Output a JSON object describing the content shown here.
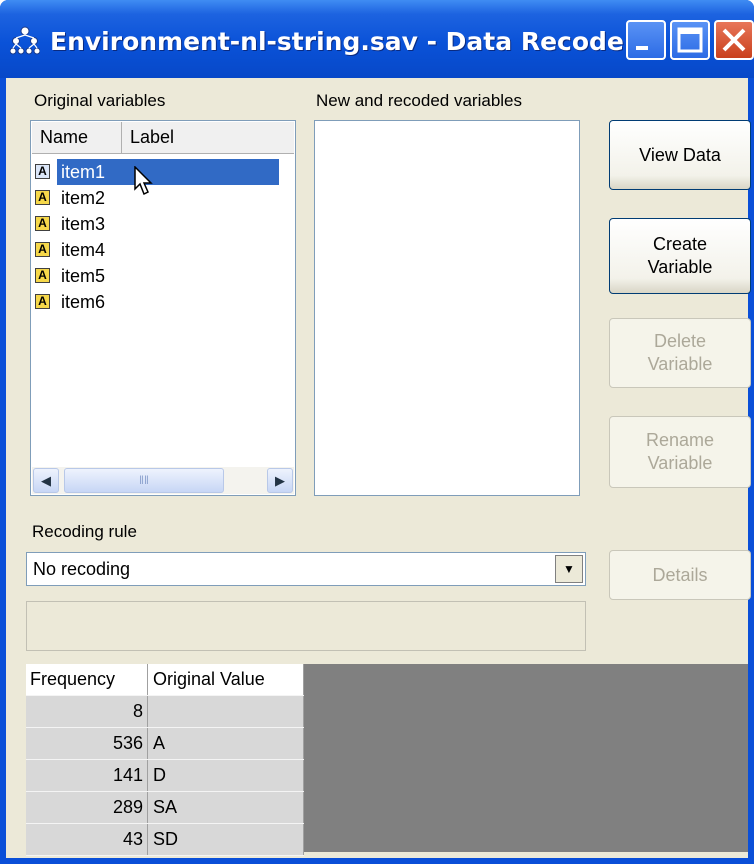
{
  "window": {
    "title": "Environment-nl-string.sav - Data Recode"
  },
  "original_variables": {
    "label": "Original variables",
    "columns": [
      "Name",
      "Label"
    ],
    "items": [
      {
        "name": "item1",
        "selected": true
      },
      {
        "name": "item2",
        "selected": false
      },
      {
        "name": "item3",
        "selected": false
      },
      {
        "name": "item4",
        "selected": false
      },
      {
        "name": "item5",
        "selected": false
      },
      {
        "name": "item6",
        "selected": false
      }
    ],
    "icon": "string-variable-icon"
  },
  "new_variables": {
    "label": "New and recoded variables"
  },
  "buttons": {
    "view_data": "View Data",
    "create_variable_line1": "Create",
    "create_variable_line2": "Variable",
    "delete_variable_line1": "Delete",
    "delete_variable_line2": "Variable",
    "rename_variable_line1": "Rename",
    "rename_variable_line2": "Variable",
    "details": "Details"
  },
  "recoding": {
    "label": "Recoding rule",
    "selected": "No recoding"
  },
  "frequency_table": {
    "headers": [
      "Frequency",
      "Original Value"
    ],
    "rows": [
      {
        "frequency": "8",
        "value": ""
      },
      {
        "frequency": "536",
        "value": "A"
      },
      {
        "frequency": "141",
        "value": "D"
      },
      {
        "frequency": "289",
        "value": "SA"
      },
      {
        "frequency": "43",
        "value": "SD"
      }
    ]
  },
  "colors": {
    "titlebar": "#0a52d8",
    "selection": "#316ac5",
    "dialog": "#ece9d8"
  }
}
